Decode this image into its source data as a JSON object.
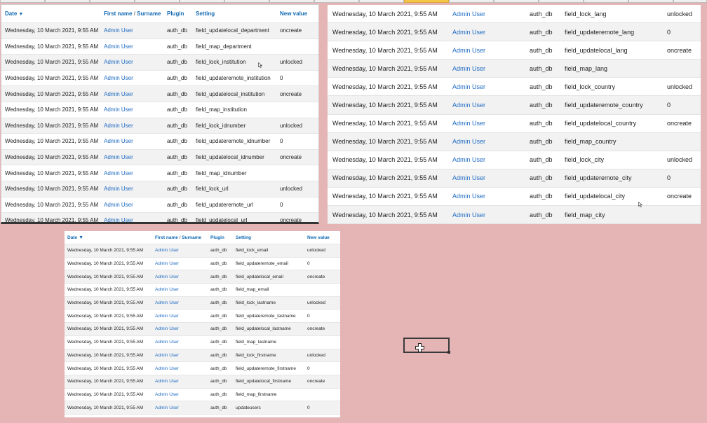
{
  "headers": {
    "date": "Date",
    "first_name": "First name",
    "surname": "Surname",
    "plugin": "Plugin",
    "setting": "Setting",
    "new_value": "New value"
  },
  "panel1_rows": [
    {
      "date": "Wednesday, 10 March 2021, 9:55 AM",
      "user": "Admin User",
      "plugin": "auth_db",
      "setting": "field_updatelocal_department",
      "value": "oncreate"
    },
    {
      "date": "Wednesday, 10 March 2021, 9:55 AM",
      "user": "Admin User",
      "plugin": "auth_db",
      "setting": "field_map_department",
      "value": ""
    },
    {
      "date": "Wednesday, 10 March 2021, 9:55 AM",
      "user": "Admin User",
      "plugin": "auth_db",
      "setting": "field_lock_institution",
      "value": "unlocked"
    },
    {
      "date": "Wednesday, 10 March 2021, 9:55 AM",
      "user": "Admin User",
      "plugin": "auth_db",
      "setting": "field_updateremote_institution",
      "value": "0"
    },
    {
      "date": "Wednesday, 10 March 2021, 9:55 AM",
      "user": "Admin User",
      "plugin": "auth_db",
      "setting": "field_updatelocal_institution",
      "value": "oncreate"
    },
    {
      "date": "Wednesday, 10 March 2021, 9:55 AM",
      "user": "Admin User",
      "plugin": "auth_db",
      "setting": "field_map_institution",
      "value": ""
    },
    {
      "date": "Wednesday, 10 March 2021, 9:55 AM",
      "user": "Admin User",
      "plugin": "auth_db",
      "setting": "field_lock_idnumber",
      "value": "unlocked"
    },
    {
      "date": "Wednesday, 10 March 2021, 9:55 AM",
      "user": "Admin User",
      "plugin": "auth_db",
      "setting": "field_updateremote_idnumber",
      "value": "0"
    },
    {
      "date": "Wednesday, 10 March 2021, 9:55 AM",
      "user": "Admin User",
      "plugin": "auth_db",
      "setting": "field_updatelocal_idnumber",
      "value": "oncreate"
    },
    {
      "date": "Wednesday, 10 March 2021, 9:55 AM",
      "user": "Admin User",
      "plugin": "auth_db",
      "setting": "field_map_idnumber",
      "value": ""
    },
    {
      "date": "Wednesday, 10 March 2021, 9:55 AM",
      "user": "Admin User",
      "plugin": "auth_db",
      "setting": "field_lock_url",
      "value": "unlocked"
    },
    {
      "date": "Wednesday, 10 March 2021, 9:55 AM",
      "user": "Admin User",
      "plugin": "auth_db",
      "setting": "field_updateremote_url",
      "value": "0"
    },
    {
      "date": "Wednesday, 10 March 2021, 9:55 AM",
      "user": "Admin User",
      "plugin": "auth_db",
      "setting": "field_updatelocal_url",
      "value": "oncreate"
    }
  ],
  "panel2_rows": [
    {
      "date": "Wednesday, 10 March 2021, 9:55 AM",
      "user": "Admin User",
      "plugin": "auth_db",
      "setting": "field_lock_lang",
      "value": "unlocked"
    },
    {
      "date": "Wednesday, 10 March 2021, 9:55 AM",
      "user": "Admin User",
      "plugin": "auth_db",
      "setting": "field_updateremote_lang",
      "value": "0"
    },
    {
      "date": "Wednesday, 10 March 2021, 9:55 AM",
      "user": "Admin User",
      "plugin": "auth_db",
      "setting": "field_updatelocal_lang",
      "value": "oncreate"
    },
    {
      "date": "Wednesday, 10 March 2021, 9:55 AM",
      "user": "Admin User",
      "plugin": "auth_db",
      "setting": "field_map_lang",
      "value": ""
    },
    {
      "date": "Wednesday, 10 March 2021, 9:55 AM",
      "user": "Admin User",
      "plugin": "auth_db",
      "setting": "field_lock_country",
      "value": "unlocked"
    },
    {
      "date": "Wednesday, 10 March 2021, 9:55 AM",
      "user": "Admin User",
      "plugin": "auth_db",
      "setting": "field_updateremote_country",
      "value": "0"
    },
    {
      "date": "Wednesday, 10 March 2021, 9:55 AM",
      "user": "Admin User",
      "plugin": "auth_db",
      "setting": "field_updatelocal_country",
      "value": "oncreate"
    },
    {
      "date": "Wednesday, 10 March 2021, 9:55 AM",
      "user": "Admin User",
      "plugin": "auth_db",
      "setting": "field_map_country",
      "value": ""
    },
    {
      "date": "Wednesday, 10 March 2021, 9:55 AM",
      "user": "Admin User",
      "plugin": "auth_db",
      "setting": "field_lock_city",
      "value": "unlocked"
    },
    {
      "date": "Wednesday, 10 March 2021, 9:55 AM",
      "user": "Admin User",
      "plugin": "auth_db",
      "setting": "field_updateremote_city",
      "value": "0"
    },
    {
      "date": "Wednesday, 10 March 2021, 9:55 AM",
      "user": "Admin User",
      "plugin": "auth_db",
      "setting": "field_updatelocal_city",
      "value": "oncreate"
    },
    {
      "date": "Wednesday, 10 March 2021, 9:55 AM",
      "user": "Admin User",
      "plugin": "auth_db",
      "setting": "field_map_city",
      "value": ""
    }
  ],
  "panel3_rows": [
    {
      "date": "Wednesday, 10 March 2021, 9:55 AM",
      "user": "Admin User",
      "plugin": "auth_db",
      "setting": "field_lock_email",
      "value": "unlocked"
    },
    {
      "date": "Wednesday, 10 March 2021, 9:55 AM",
      "user": "Admin User",
      "plugin": "auth_db",
      "setting": "field_updateremote_email",
      "value": "0"
    },
    {
      "date": "Wednesday, 10 March 2021, 9:55 AM",
      "user": "Admin User",
      "plugin": "auth_db",
      "setting": "field_updatelocal_email",
      "value": "oncreate"
    },
    {
      "date": "Wednesday, 10 March 2021, 9:55 AM",
      "user": "Admin User",
      "plugin": "auth_db",
      "setting": "field_map_email",
      "value": ""
    },
    {
      "date": "Wednesday, 10 March 2021, 9:55 AM",
      "user": "Admin User",
      "plugin": "auth_db",
      "setting": "field_lock_lastname",
      "value": "unlocked"
    },
    {
      "date": "Wednesday, 10 March 2021, 9:55 AM",
      "user": "Admin User",
      "plugin": "auth_db",
      "setting": "field_updateremote_lastname",
      "value": "0"
    },
    {
      "date": "Wednesday, 10 March 2021, 9:55 AM",
      "user": "Admin User",
      "plugin": "auth_db",
      "setting": "field_updatelocal_lastname",
      "value": "oncreate"
    },
    {
      "date": "Wednesday, 10 March 2021, 9:55 AM",
      "user": "Admin User",
      "plugin": "auth_db",
      "setting": "field_map_lastname",
      "value": ""
    },
    {
      "date": "Wednesday, 10 March 2021, 9:55 AM",
      "user": "Admin User",
      "plugin": "auth_db",
      "setting": "field_lock_firstname",
      "value": "unlocked"
    },
    {
      "date": "Wednesday, 10 March 2021, 9:55 AM",
      "user": "Admin User",
      "plugin": "auth_db",
      "setting": "field_updateremote_firstname",
      "value": "0"
    },
    {
      "date": "Wednesday, 10 March 2021, 9:55 AM",
      "user": "Admin User",
      "plugin": "auth_db",
      "setting": "field_updatelocal_firstname",
      "value": "oncreate"
    },
    {
      "date": "Wednesday, 10 March 2021, 9:55 AM",
      "user": "Admin User",
      "plugin": "auth_db",
      "setting": "field_map_firstname",
      "value": ""
    },
    {
      "date": "Wednesday, 10 March 2021, 9:55 AM",
      "user": "Admin User",
      "plugin": "auth_db",
      "setting": "updateusers",
      "value": "0"
    }
  ],
  "icons": {
    "sort": "sort-descending-icon",
    "cursor": "crosshair-cursor-icon",
    "pointer": "mouse-pointer-icon"
  },
  "colors": {
    "link": "#1f6bc2",
    "header": "#1169b2",
    "background": "#e5b5b5",
    "active_tab": "#f6c447"
  }
}
